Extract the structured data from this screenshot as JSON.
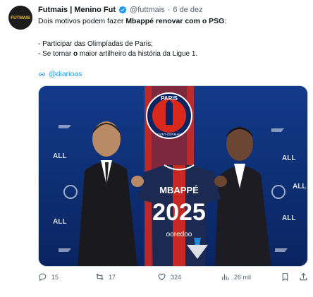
{
  "author": {
    "avatar_text": "FUTMAIS",
    "name": "Futmais | Menino Fut",
    "handle": "@futtmais",
    "separator": "·",
    "date": "6 de dez"
  },
  "tweet": {
    "line1_prefix": "Dois motivos podem fazer ",
    "line1_bold": "Mbappé renovar com o PSG",
    "line1_suffix": ":",
    "line2": "- Participar das Olimpíadas de Paris;",
    "line3_prefix": "- Se tornar ",
    "line3_bold": "o",
    "line3_suffix": " maior artilheiro da história da Ligue 1.",
    "link_text": "@diarioas"
  },
  "media": {
    "jersey_name": "MBAPPÉ",
    "jersey_number": "2025",
    "sponsor": "ooredoo",
    "crest_text": "PARIS",
    "crest_sub": "SAINT-GERMAIN",
    "board_text": "ALL"
  },
  "actions": {
    "replies": "15",
    "retweets": "17",
    "likes": "324",
    "views": "26 mil"
  },
  "colors": {
    "accent": "#1d9bf0",
    "psg_navy": "#0b2a6b",
    "psg_red": "#da291c"
  }
}
